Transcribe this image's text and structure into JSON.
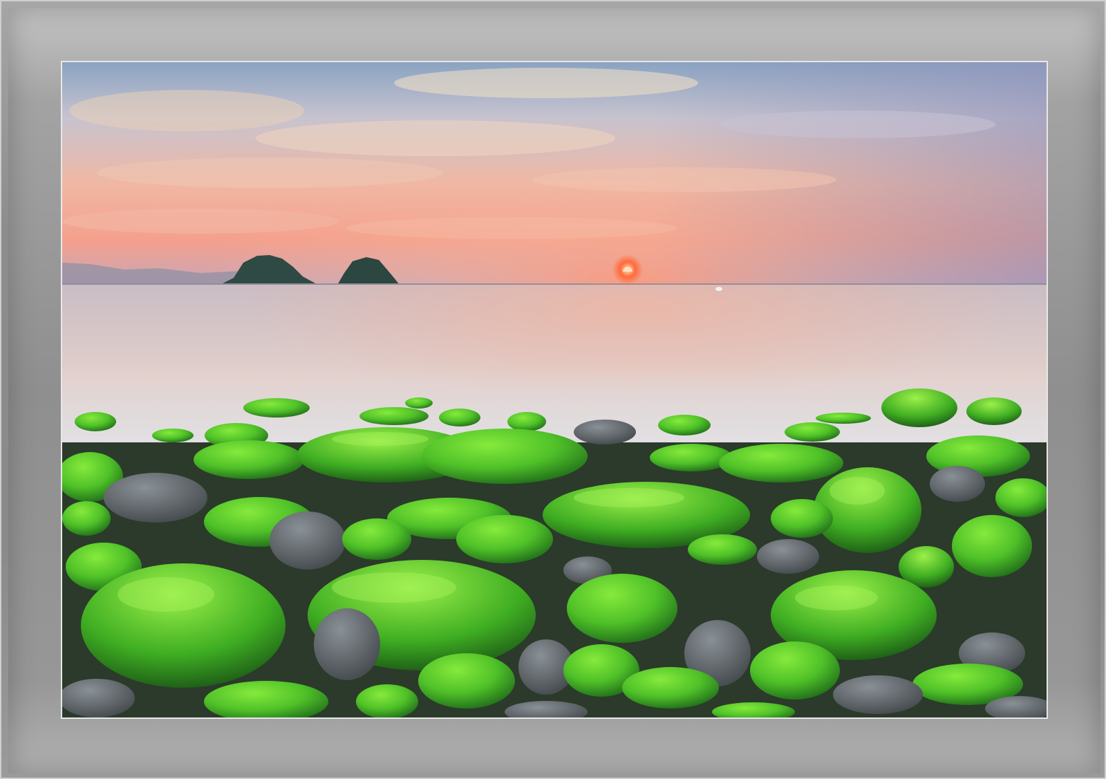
{
  "image": {
    "subject": "",
    "colors": {
      "frame_outer": "#8c8c8c",
      "frame_inner": "#a3a3a3",
      "mat_line": "#e8e8e8",
      "sky_top": "#8fa6c4",
      "sky_horizon": "#f3a78f",
      "sun": "#ff5a3c",
      "sea": "#d9c7c9",
      "moss": "#4fc72a",
      "stone": "#5f6468"
    }
  }
}
